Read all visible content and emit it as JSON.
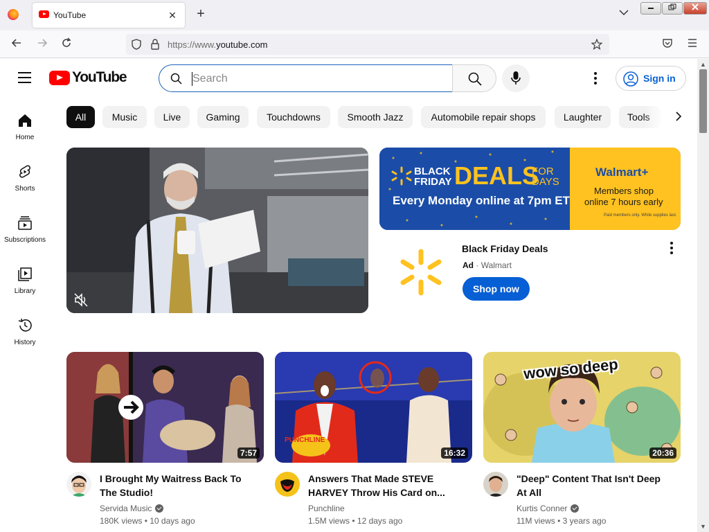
{
  "browser": {
    "tab_title": "YouTube",
    "url_prefix": "https://www.",
    "url_domain": "youtube.com",
    "new_tab": "+",
    "tab_close": "✕"
  },
  "masthead": {
    "logo_text": "YouTube",
    "search_placeholder": "Search",
    "sign_in": "Sign in"
  },
  "guide": [
    {
      "label": "Home",
      "icon": "home-icon"
    },
    {
      "label": "Shorts",
      "icon": "shorts-icon"
    },
    {
      "label": "Subscriptions",
      "icon": "subscriptions-icon"
    },
    {
      "label": "Library",
      "icon": "library-icon"
    },
    {
      "label": "History",
      "icon": "history-icon"
    }
  ],
  "chips": [
    "All",
    "Music",
    "Live",
    "Gaming",
    "Touchdowns",
    "Smooth Jazz",
    "Automobile repair shops",
    "Laughter",
    "Tools"
  ],
  "ad": {
    "banner_black_friday_1": "BLACK",
    "banner_black_friday_2": "FRIDAY",
    "banner_deals": "DEALS",
    "banner_for_days_1": "FOR",
    "banner_for_days_2": "DAYS",
    "banner_subline": "Every Monday online at 7pm ET",
    "banner_brand": "Walmart+",
    "banner_members_1": "Members shop",
    "banner_members_2": "online 7 hours early",
    "banner_fine_print": "Paid members only. While supplies last.",
    "title": "Black Friday Deals",
    "label": "Ad",
    "separator": "·",
    "advertiser": "Walmart",
    "cta": "Shop now"
  },
  "videos": [
    {
      "title": "I Brought My Waitress Back To The Studio!",
      "channel": "Servida Music",
      "verified": true,
      "views": "180K views",
      "age": "10 days ago",
      "duration": "7:57"
    },
    {
      "title": "Answers That Made STEVE HARVEY Throw His Card on...",
      "channel": "Punchline",
      "verified": false,
      "views": "1.5M views",
      "age": "12 days ago",
      "duration": "16:32",
      "thumb_text": "PUNCHLINE"
    },
    {
      "title": "\"Deep\" Content That Isn't Deep At All",
      "channel": "Kurtis Conner",
      "verified": true,
      "views": "11M views",
      "age": "3 years ago",
      "duration": "20:36",
      "thumb_text": "wow so deep"
    }
  ],
  "colors": {
    "youtube_red": "#ff0000",
    "link_blue": "#065fd4",
    "walmart_blue": "#1b4da8",
    "walmart_yellow": "#ffc220"
  }
}
